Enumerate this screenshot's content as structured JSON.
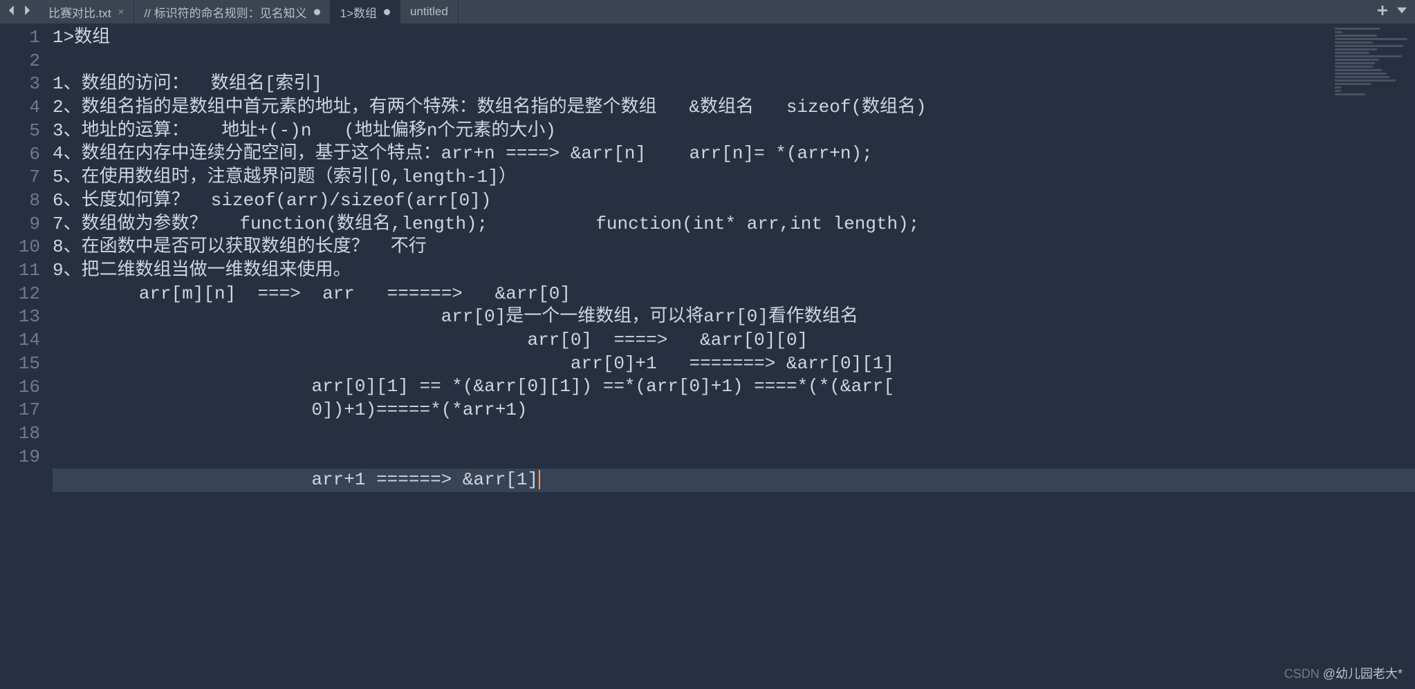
{
  "tabs": [
    {
      "label": "比赛对比.txt",
      "active": false,
      "showClose": true,
      "dirty": false
    },
    {
      "label": "// 标识符的命名规则：见名知义",
      "active": false,
      "showClose": false,
      "dirty": true
    },
    {
      "label": "1>数组",
      "active": true,
      "showClose": false,
      "dirty": true
    },
    {
      "label": "untitled",
      "active": false,
      "showClose": false,
      "dirty": false
    }
  ],
  "lines": [
    {
      "n": "1",
      "text": "1>数组"
    },
    {
      "n": "2",
      "text": ""
    },
    {
      "n": "3",
      "text": "1、数组的访问：  数组名[索引]"
    },
    {
      "n": "4",
      "text": "2、数组名指的是数组中首元素的地址，有两个特殊：数组名指的是整个数组   &数组名   sizeof(数组名)"
    },
    {
      "n": "5",
      "text": "3、地址的运算：   地址+(-)n   (地址偏移n个元素的大小)"
    },
    {
      "n": "6",
      "text": "4、数组在内存中连续分配空间，基于这个特点：arr+n ====> &arr[n]    arr[n]= *(arr+n);"
    },
    {
      "n": "7",
      "text": "5、在使用数组时，注意越界问题（索引[0,length-1]）"
    },
    {
      "n": "8",
      "text": "6、长度如何算？  sizeof(arr)/sizeof(arr[0])"
    },
    {
      "n": "9",
      "text": "7、数组做为参数？   function(数组名,length);          function(int* arr,int length);"
    },
    {
      "n": "10",
      "text": "8、在函数中是否可以获取数组的长度？  不行"
    },
    {
      "n": "11",
      "text": "9、把二维数组当做一维数组来使用。"
    },
    {
      "n": "12",
      "text": "        arr[m][n]  ===>  arr   ======>   &arr[0]"
    },
    {
      "n": "13",
      "text": "                                    arr[0]是一个一维数组，可以将arr[0]看作数组名"
    },
    {
      "n": "14",
      "text": "                                            arr[0]  ====>   &arr[0][0]"
    },
    {
      "n": "15",
      "text": "                                                arr[0]+1   =======> &arr[0][1]"
    },
    {
      "n": "16",
      "text": "                        arr[0][1] == *(&arr[0][1]) ==*(arr[0]+1) ====*(*(&arr["
    },
    {
      "n": "",
      "text": "                        0])+1)=====*(*arr+1)"
    },
    {
      "n": "17",
      "text": ""
    },
    {
      "n": "18",
      "text": ""
    },
    {
      "n": "19",
      "text": "                        arr+1 ======> &arr[1]",
      "hl": true,
      "cursor": true
    }
  ],
  "watermark": {
    "prefix": "CSDN ",
    "author": "@幼儿园老大*"
  },
  "minimapLines": [
    60,
    10,
    55,
    95,
    50,
    90,
    55,
    45,
    88,
    58,
    53,
    50,
    62,
    68,
    72,
    80,
    48,
    8,
    8,
    40
  ]
}
